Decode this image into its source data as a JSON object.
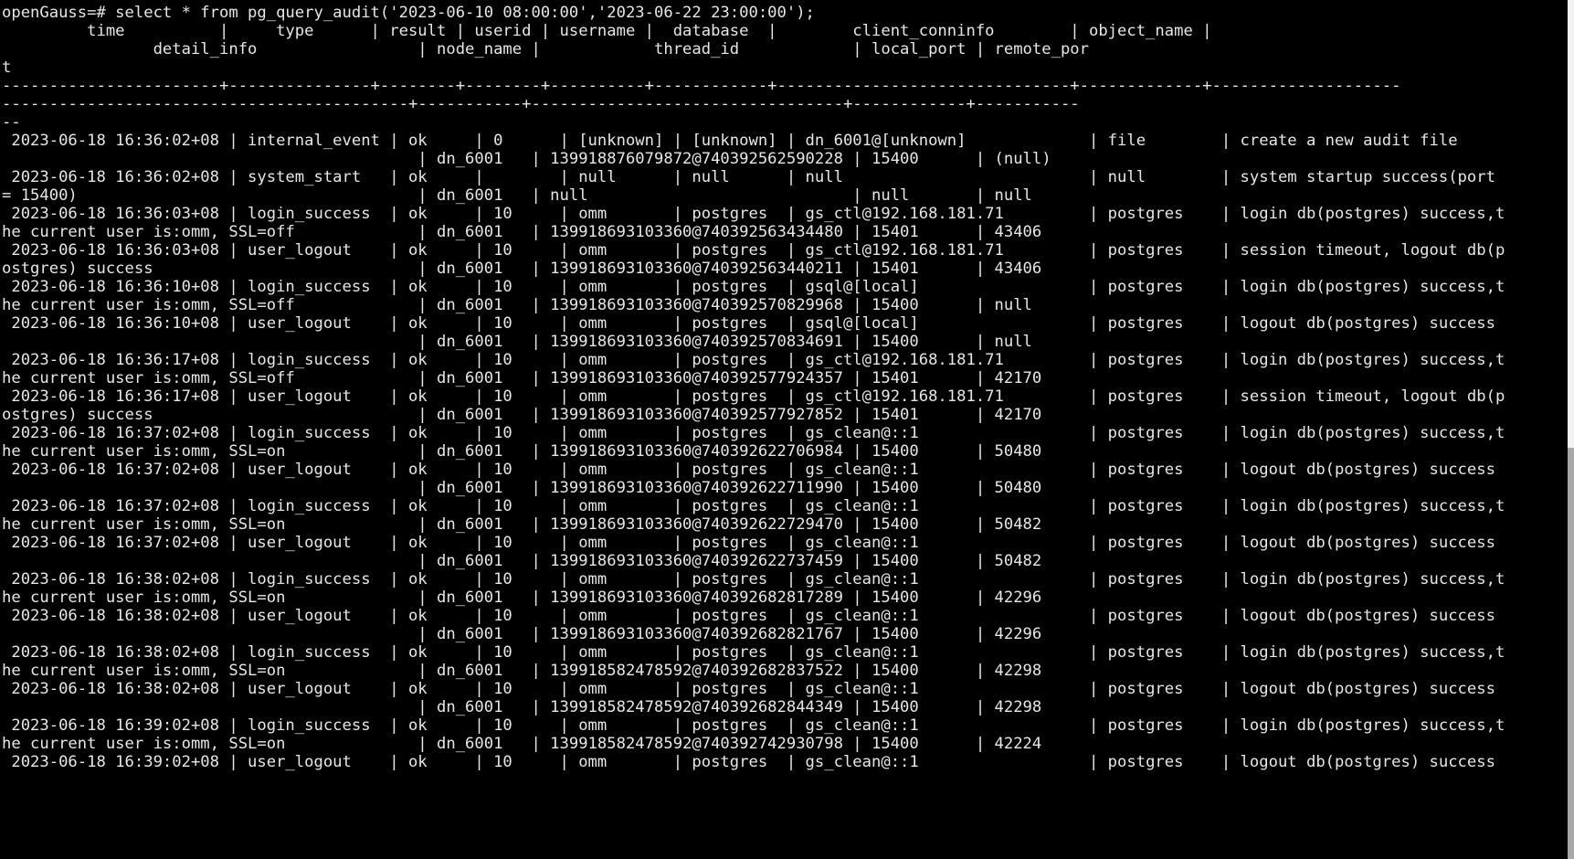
{
  "terminal": {
    "background_color": "#000000",
    "foreground_color": "#e6e6e6",
    "prompt": "openGauss=# ",
    "command": "select * from pg_query_audit('2023-06-10 08:00:00','2023-06-22 23:00:00');",
    "columns_line_1": "         time          |     type      | result | userid | username |  database  |        client_conninfo        | object_name |",
    "columns_line_2": "               detail_info                                                 | node_name |           thread_id            | local_port | remote_por",
    "columns_line_3": "t",
    "separator_line_1": "-----------------------+---------------+--------+--------+----------+------------+-------------------------------+-------------+-------------------------",
    "separator_line_2": "------------------------------------------------------------------------+-----------+--------------------------------+------------+------------",
    "separator_line_3": "--"
  },
  "table": {
    "headers_row1": [
      "time",
      "type",
      "result",
      "userid",
      "username",
      "database",
      "client_conninfo",
      "object_name"
    ],
    "headers_row2": [
      "detail_info",
      "node_name",
      "thread_id",
      "local_port",
      "remote_port"
    ],
    "rows": [
      {
        "time": "2023-06-18 16:36:02+08",
        "type": "internal_event",
        "result": "ok",
        "userid": "0",
        "username": "[unknown]",
        "database": "[unknown]",
        "client_conninfo": "dn_6001@[unknown]",
        "object_name": "file",
        "detail_info": "create a new audit file",
        "node_name": "dn_6001",
        "thread_id": "139918876079872@740392562590228",
        "local_port": "15400",
        "remote_port": "(null)"
      },
      {
        "time": "2023-06-18 16:36:02+08",
        "type": "system_start",
        "result": "ok",
        "userid": "",
        "username": "null",
        "database": "null",
        "client_conninfo": "null",
        "object_name": "null",
        "detail_info": "system startup success(port = 15400)",
        "node_name": "dn_6001",
        "thread_id": "null",
        "local_port": "null",
        "remote_port": "null"
      },
      {
        "time": "2023-06-18 16:36:03+08",
        "type": "login_success",
        "result": "ok",
        "userid": "10",
        "username": "omm",
        "database": "postgres",
        "client_conninfo": "gs_ctl@192.168.181.71",
        "object_name": "postgres",
        "detail_info": "login db(postgres) success,the current user is:omm, SSL=off",
        "node_name": "dn_6001",
        "thread_id": "139918693103360@740392563434480",
        "local_port": "15401",
        "remote_port": "43406"
      },
      {
        "time": "2023-06-18 16:36:03+08",
        "type": "user_logout",
        "result": "ok",
        "userid": "10",
        "username": "omm",
        "database": "postgres",
        "client_conninfo": "gs_ctl@192.168.181.71",
        "object_name": "postgres",
        "detail_info": "session timeout, logout db(postgres) success",
        "node_name": "dn_6001",
        "thread_id": "139918693103360@740392563440211",
        "local_port": "15401",
        "remote_port": "43406"
      },
      {
        "time": "2023-06-18 16:36:10+08",
        "type": "login_success",
        "result": "ok",
        "userid": "10",
        "username": "omm",
        "database": "postgres",
        "client_conninfo": "gsql@[local]",
        "object_name": "postgres",
        "detail_info": "login db(postgres) success,the current user is:omm, SSL=off",
        "node_name": "dn_6001",
        "thread_id": "139918693103360@740392570829968",
        "local_port": "15400",
        "remote_port": "null"
      },
      {
        "time": "2023-06-18 16:36:10+08",
        "type": "user_logout",
        "result": "ok",
        "userid": "10",
        "username": "omm",
        "database": "postgres",
        "client_conninfo": "gsql@[local]",
        "object_name": "postgres",
        "detail_info": "logout db(postgres) success",
        "node_name": "dn_6001",
        "thread_id": "139918693103360@740392570834691",
        "local_port": "15400",
        "remote_port": "null"
      },
      {
        "time": "2023-06-18 16:36:17+08",
        "type": "login_success",
        "result": "ok",
        "userid": "10",
        "username": "omm",
        "database": "postgres",
        "client_conninfo": "gs_ctl@192.168.181.71",
        "object_name": "postgres",
        "detail_info": "login db(postgres) success,the current user is:omm, SSL=off",
        "node_name": "dn_6001",
        "thread_id": "139918693103360@740392577924357",
        "local_port": "15401",
        "remote_port": "42170"
      },
      {
        "time": "2023-06-18 16:36:17+08",
        "type": "user_logout",
        "result": "ok",
        "userid": "10",
        "username": "omm",
        "database": "postgres",
        "client_conninfo": "gs_ctl@192.168.181.71",
        "object_name": "postgres",
        "detail_info": "session timeout, logout db(postgres) success",
        "node_name": "dn_6001",
        "thread_id": "139918693103360@740392577927852",
        "local_port": "15401",
        "remote_port": "42170"
      },
      {
        "time": "2023-06-18 16:37:02+08",
        "type": "login_success",
        "result": "ok",
        "userid": "10",
        "username": "omm",
        "database": "postgres",
        "client_conninfo": "gs_clean@::1",
        "object_name": "postgres",
        "detail_info": "login db(postgres) success,the current user is:omm, SSL=on",
        "node_name": "dn_6001",
        "thread_id": "139918693103360@740392622706984",
        "local_port": "15400",
        "remote_port": "50480"
      },
      {
        "time": "2023-06-18 16:37:02+08",
        "type": "user_logout",
        "result": "ok",
        "userid": "10",
        "username": "omm",
        "database": "postgres",
        "client_conninfo": "gs_clean@::1",
        "object_name": "postgres",
        "detail_info": "logout db(postgres) success",
        "node_name": "dn_6001",
        "thread_id": "139918693103360@740392622711990",
        "local_port": "15400",
        "remote_port": "50480"
      },
      {
        "time": "2023-06-18 16:37:02+08",
        "type": "login_success",
        "result": "ok",
        "userid": "10",
        "username": "omm",
        "database": "postgres",
        "client_conninfo": "gs_clean@::1",
        "object_name": "postgres",
        "detail_info": "login db(postgres) success,the current user is:omm, SSL=on",
        "node_name": "dn_6001",
        "thread_id": "139918693103360@740392622729470",
        "local_port": "15400",
        "remote_port": "50482"
      },
      {
        "time": "2023-06-18 16:37:02+08",
        "type": "user_logout",
        "result": "ok",
        "userid": "10",
        "username": "omm",
        "database": "postgres",
        "client_conninfo": "gs_clean@::1",
        "object_name": "postgres",
        "detail_info": "logout db(postgres) success",
        "node_name": "dn_6001",
        "thread_id": "139918693103360@740392622737459",
        "local_port": "15400",
        "remote_port": "50482"
      },
      {
        "time": "2023-06-18 16:38:02+08",
        "type": "login_success",
        "result": "ok",
        "userid": "10",
        "username": "omm",
        "database": "postgres",
        "client_conninfo": "gs_clean@::1",
        "object_name": "postgres",
        "detail_info": "login db(postgres) success,the current user is:omm, SSL=on",
        "node_name": "dn_6001",
        "thread_id": "139918693103360@740392682817289",
        "local_port": "15400",
        "remote_port": "42296"
      },
      {
        "time": "2023-06-18 16:38:02+08",
        "type": "user_logout",
        "result": "ok",
        "userid": "10",
        "username": "omm",
        "database": "postgres",
        "client_conninfo": "gs_clean@::1",
        "object_name": "postgres",
        "detail_info": "logout db(postgres) success",
        "node_name": "dn_6001",
        "thread_id": "139918693103360@740392682821767",
        "local_port": "15400",
        "remote_port": "42296"
      },
      {
        "time": "2023-06-18 16:38:02+08",
        "type": "login_success",
        "result": "ok",
        "userid": "10",
        "username": "omm",
        "database": "postgres",
        "client_conninfo": "gs_clean@::1",
        "object_name": "postgres",
        "detail_info": "login db(postgres) success,the current user is:omm, SSL=on",
        "node_name": "dn_6001",
        "thread_id": "139918582478592@740392682837522",
        "local_port": "15400",
        "remote_port": "42298"
      },
      {
        "time": "2023-06-18 16:38:02+08",
        "type": "user_logout",
        "result": "ok",
        "userid": "10",
        "username": "omm",
        "database": "postgres",
        "client_conninfo": "gs_clean@::1",
        "object_name": "postgres",
        "detail_info": "logout db(postgres) success",
        "node_name": "dn_6001",
        "thread_id": "139918582478592@740392682844349",
        "local_port": "15400",
        "remote_port": "42298"
      },
      {
        "time": "2023-06-18 16:39:02+08",
        "type": "login_success",
        "result": "ok",
        "userid": "10",
        "username": "omm",
        "database": "postgres",
        "client_conninfo": "gs_clean@::1",
        "object_name": "postgres",
        "detail_info": "login db(postgres) success,the current user is:omm, SSL=on",
        "node_name": "dn_6001",
        "thread_id": "139918582478592@740392742930798",
        "local_port": "15400",
        "remote_port": "42224"
      },
      {
        "time": "2023-06-18 16:39:02+08",
        "type": "user_logout",
        "result": "ok",
        "userid": "10",
        "username": "omm",
        "database": "postgres",
        "client_conninfo": "gs_clean@::1",
        "object_name": "postgres",
        "detail_info": "logout db(postgres) success",
        "node_name": "",
        "thread_id": "",
        "local_port": "",
        "remote_port": ""
      }
    ]
  },
  "lines": [
    "openGauss=# select * from pg_query_audit('2023-06-10 08:00:00','2023-06-22 23:00:00');",
    "         time          |     type      | result | userid | username |  database  |        client_conninfo        | object_name |",
    "                detail_info                 | node_name |            thread_id            | local_port | remote_por",
    "t",
    "-----------------------+---------------+--------+--------+----------+------------+-------------------------------+-------------+--------------------",
    "-------------------------------------------+-----------+---------------------------------+------------+-----------",
    "--",
    " 2023-06-18 16:36:02+08 | internal_event | ok     | 0      | [unknown] | [unknown] | dn_6001@[unknown]             | file        | create a new audit file",
    "                                            | dn_6001   | 139918876079872@740392562590228 | 15400      | (null)",
    " 2023-06-18 16:36:02+08 | system_start   | ok     |        | null      | null      | null                          | null        | system startup success(port",
    "= 15400)                                    | dn_6001   | null                            | null       | null",
    " 2023-06-18 16:36:03+08 | login_success  | ok     | 10     | omm       | postgres  | gs_ctl@192.168.181.71         | postgres    | login db(postgres) success,t",
    "he current user is:omm, SSL=off             | dn_6001   | 139918693103360@740392563434480 | 15401      | 43406",
    " 2023-06-18 16:36:03+08 | user_logout    | ok     | 10     | omm       | postgres  | gs_ctl@192.168.181.71         | postgres    | session timeout, logout db(p",
    "ostgres) success                            | dn_6001   | 139918693103360@740392563440211 | 15401      | 43406",
    " 2023-06-18 16:36:10+08 | login_success  | ok     | 10     | omm       | postgres  | gsql@[local]                  | postgres    | login db(postgres) success,t",
    "he current user is:omm, SSL=off             | dn_6001   | 139918693103360@740392570829968 | 15400      | null",
    " 2023-06-18 16:36:10+08 | user_logout    | ok     | 10     | omm       | postgres  | gsql@[local]                  | postgres    | logout db(postgres) success",
    "                                            | dn_6001   | 139918693103360@740392570834691 | 15400      | null",
    " 2023-06-18 16:36:17+08 | login_success  | ok     | 10     | omm       | postgres  | gs_ctl@192.168.181.71         | postgres    | login db(postgres) success,t",
    "he current user is:omm, SSL=off             | dn_6001   | 139918693103360@740392577924357 | 15401      | 42170",
    " 2023-06-18 16:36:17+08 | user_logout    | ok     | 10     | omm       | postgres  | gs_ctl@192.168.181.71         | postgres    | session timeout, logout db(p",
    "ostgres) success                            | dn_6001   | 139918693103360@740392577927852 | 15401      | 42170",
    " 2023-06-18 16:37:02+08 | login_success  | ok     | 10     | omm       | postgres  | gs_clean@::1                  | postgres    | login db(postgres) success,t",
    "he current user is:omm, SSL=on              | dn_6001   | 139918693103360@740392622706984 | 15400      | 50480",
    " 2023-06-18 16:37:02+08 | user_logout    | ok     | 10     | omm       | postgres  | gs_clean@::1                  | postgres    | logout db(postgres) success",
    "                                            | dn_6001   | 139918693103360@740392622711990 | 15400      | 50480",
    " 2023-06-18 16:37:02+08 | login_success  | ok     | 10     | omm       | postgres  | gs_clean@::1                  | postgres    | login db(postgres) success,t",
    "he current user is:omm, SSL=on              | dn_6001   | 139918693103360@740392622729470 | 15400      | 50482",
    " 2023-06-18 16:37:02+08 | user_logout    | ok     | 10     | omm       | postgres  | gs_clean@::1                  | postgres    | logout db(postgres) success",
    "                                            | dn_6001   | 139918693103360@740392622737459 | 15400      | 50482",
    " 2023-06-18 16:38:02+08 | login_success  | ok     | 10     | omm       | postgres  | gs_clean@::1                  | postgres    | login db(postgres) success,t",
    "he current user is:omm, SSL=on              | dn_6001   | 139918693103360@740392682817289 | 15400      | 42296",
    " 2023-06-18 16:38:02+08 | user_logout    | ok     | 10     | omm       | postgres  | gs_clean@::1                  | postgres    | logout db(postgres) success",
    "                                            | dn_6001   | 139918693103360@740392682821767 | 15400      | 42296",
    " 2023-06-18 16:38:02+08 | login_success  | ok     | 10     | omm       | postgres  | gs_clean@::1                  | postgres    | login db(postgres) success,t",
    "he current user is:omm, SSL=on              | dn_6001   | 139918582478592@740392682837522 | 15400      | 42298",
    " 2023-06-18 16:38:02+08 | user_logout    | ok     | 10     | omm       | postgres  | gs_clean@::1                  | postgres    | logout db(postgres) success",
    "                                            | dn_6001   | 139918582478592@740392682844349 | 15400      | 42298",
    " 2023-06-18 16:39:02+08 | login_success  | ok     | 10     | omm       | postgres  | gs_clean@::1                  | postgres    | login db(postgres) success,t",
    "he current user is:omm, SSL=on              | dn_6001   | 139918582478592@740392742930798 | 15400      | 42224",
    " 2023-06-18 16:39:02+08 | user_logout    | ok     | 10     | omm       | postgres  | gs_clean@::1                  | postgres    | logout db(postgres) success"
  ],
  "scrollbar": {
    "track_color": "#f2f2f2",
    "thumb_color": "#a8a8a8"
  }
}
